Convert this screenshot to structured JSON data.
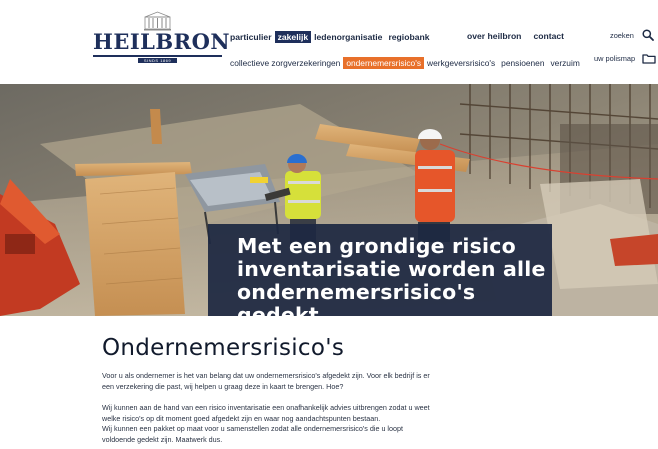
{
  "brand": {
    "name": "HEILBRON",
    "tagline": "SINDS 1869",
    "navy": "#1e2f5b",
    "orange": "#e8702a"
  },
  "nav": {
    "main": [
      {
        "label": "particulier",
        "active": false
      },
      {
        "label": "zakelijk",
        "active": true
      },
      {
        "label": "ledenorganisatie",
        "active": false
      },
      {
        "label": "regiobank",
        "active": false
      }
    ],
    "right": [
      {
        "label": "over heilbron"
      },
      {
        "label": "contact"
      }
    ],
    "sub": [
      {
        "label": "collectieve zorgverzekeringen",
        "active": false
      },
      {
        "label": "ondernemersrisico's",
        "active": true
      },
      {
        "label": "werkgeversrisico's",
        "active": false
      },
      {
        "label": "pensioenen",
        "active": false
      },
      {
        "label": "verzuim",
        "active": false
      }
    ]
  },
  "utility": {
    "search_label": "zoeken",
    "search_icon": "search-icon",
    "polis_label": "uw polismap",
    "polis_icon": "folder-icon"
  },
  "hero": {
    "line1": "Met een grondige risico",
    "line2": "inventarisatie worden alle",
    "line3": "ondernemersrisico's gedekt."
  },
  "content": {
    "title": "Ondernemersrisico's",
    "intro": "Voor u als ondernemer is het van belang dat uw ondernemersrisico's afgedekt zijn. Voor elk bedrijf is er een verzekering die past, wij helpen u graag deze in kaart te brengen. Hoe?",
    "para1": "Wij kunnen aan de hand van een risico inventarisatie een onafhankelijk advies uitbrengen zodat u weet welke risico's op dit moment goed afgedekt zijn en waar nog aandachtspunten bestaan.",
    "para2": "Wij kunnen een pakket op maat voor u samenstellen zodat alle ondernemersrisico's die u loopt voldoende gedekt zijn. Maatwerk dus."
  }
}
